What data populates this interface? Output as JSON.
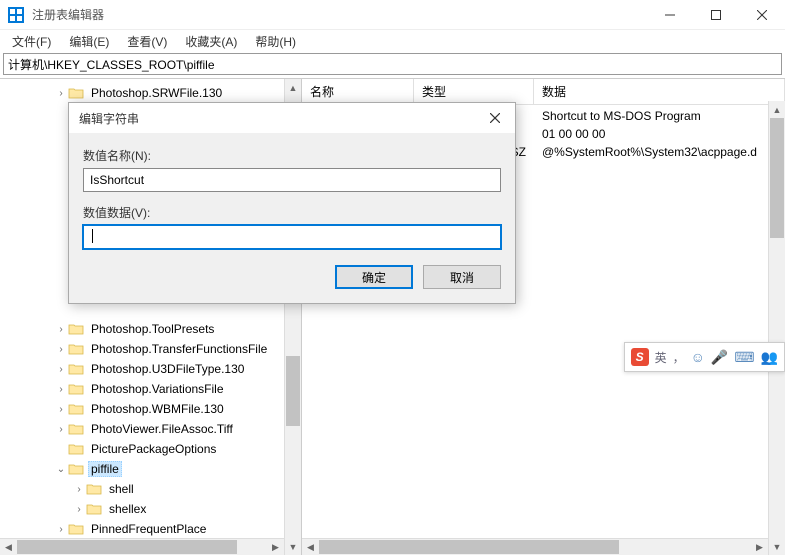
{
  "window": {
    "title": "注册表编辑器"
  },
  "menu": {
    "file": "文件(F)",
    "edit": "编辑(E)",
    "view": "查看(V)",
    "fav": "收藏夹(A)",
    "help": "帮助(H)"
  },
  "addressbar": {
    "path": "计算机\\HKEY_CLASSES_ROOT\\piffile"
  },
  "tree": {
    "items": [
      {
        "indent": 2,
        "tw": "›",
        "label": "Photoshop.SRWFile.130"
      },
      {
        "indent": 2,
        "tw": "›",
        "label": "Photoshop.ToolPresets"
      },
      {
        "indent": 2,
        "tw": "›",
        "label": "Photoshop.TransferFunctionsFile"
      },
      {
        "indent": 2,
        "tw": "›",
        "label": "Photoshop.U3DFileType.130"
      },
      {
        "indent": 2,
        "tw": "›",
        "label": "Photoshop.VariationsFile"
      },
      {
        "indent": 2,
        "tw": "›",
        "label": "Photoshop.WBMFile.130"
      },
      {
        "indent": 2,
        "tw": "›",
        "label": "PhotoViewer.FileAssoc.Tiff"
      },
      {
        "indent": 2,
        "tw": "",
        "label": "PicturePackageOptions"
      },
      {
        "indent": 2,
        "tw": "⌄",
        "label": "piffile",
        "selected": true
      },
      {
        "indent": 3,
        "tw": "›",
        "label": "shell"
      },
      {
        "indent": 3,
        "tw": "›",
        "label": "shellex"
      },
      {
        "indent": 2,
        "tw": "›",
        "label": "PinnedFrequentPlace"
      }
    ]
  },
  "list": {
    "headers": {
      "name": "名称",
      "type": "类型",
      "data": "数据"
    },
    "rows": [
      {
        "name": "",
        "type": "",
        "data": "Shortcut to MS-DOS Program"
      },
      {
        "name": "",
        "type": "",
        "data": "01 00 00 00"
      },
      {
        "name": "",
        "type": "SZ",
        "data": "@%SystemRoot%\\System32\\acppage.d"
      }
    ]
  },
  "dialog": {
    "title": "编辑字符串",
    "name_label": "数值名称(N):",
    "name_value": "IsShortcut",
    "data_label": "数值数据(V):",
    "data_value": "",
    "ok": "确定",
    "cancel": "取消"
  },
  "ime": {
    "s": "S",
    "lang": "英",
    "comma": "，",
    "smile": "☺",
    "mic": "🎤",
    "kbd": "⌨",
    "user": "👥"
  }
}
